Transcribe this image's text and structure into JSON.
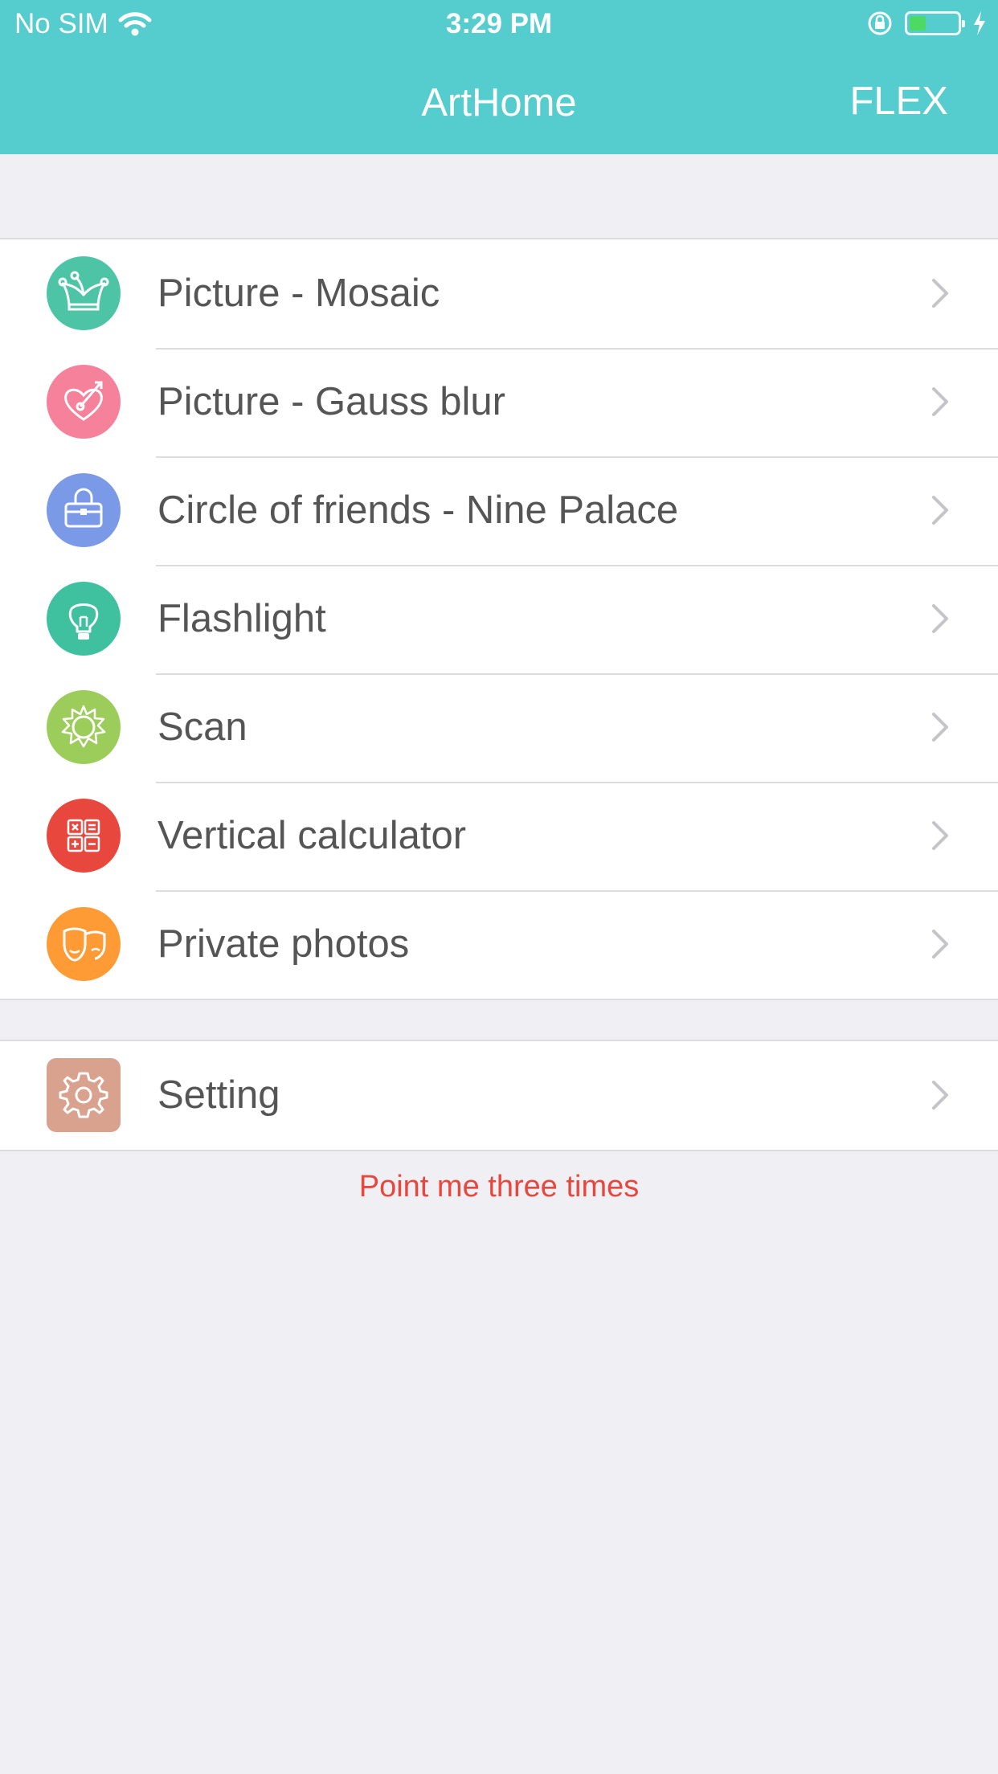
{
  "status_bar": {
    "carrier": "No SIM",
    "time": "3:29 PM",
    "battery_level": 0.34
  },
  "nav": {
    "title": "ArtHome",
    "right_button": "FLEX"
  },
  "menu": [
    {
      "label": "Picture - Mosaic",
      "icon": "jester-hat-icon",
      "color": "#4dc4a6"
    },
    {
      "label": "Picture - Gauss blur",
      "icon": "heart-arrow-icon",
      "color": "#f6819a"
    },
    {
      "label": "Circle of friends - Nine Palace",
      "icon": "bag-icon",
      "color": "#7a9ae8"
    },
    {
      "label": "Flashlight",
      "icon": "lightbulb-icon",
      "color": "#3fc1a0"
    },
    {
      "label": "Scan",
      "icon": "sun-icon",
      "color": "#9ccd5a"
    },
    {
      "label": "Vertical calculator",
      "icon": "calculator-icon",
      "color": "#e8473d"
    },
    {
      "label": "Private photos",
      "icon": "theater-masks-icon",
      "color": "#ff9b35"
    }
  ],
  "settings": {
    "label": "Setting",
    "icon": "gear-icon",
    "color": "#d9a28e"
  },
  "footer_link": "Point me three times",
  "colors": {
    "nav_background": "#55cccd",
    "page_background": "#efeff4",
    "footer_link": "#e8473d"
  }
}
